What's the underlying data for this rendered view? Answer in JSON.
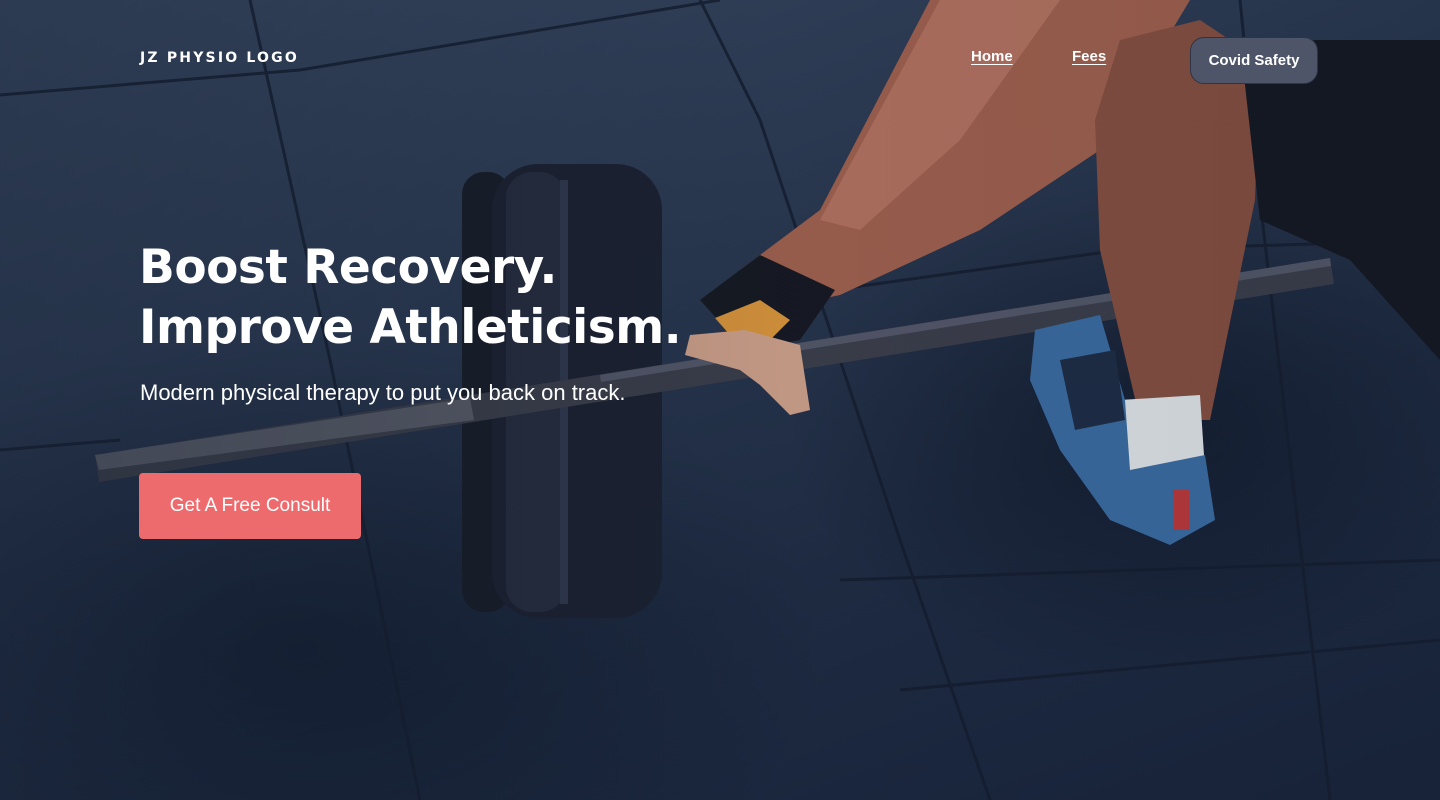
{
  "header": {
    "logo_text": "JZ PHYSIO LOGO",
    "nav": {
      "home_label": "Home",
      "fees_label": "Fees",
      "covid_label": "Covid Safety"
    }
  },
  "hero": {
    "headline_line1": "Boost Recovery.",
    "headline_line2": "Improve Athleticism.",
    "subheading": "Modern physical therapy to put you back on track.",
    "cta_label": "Get A Free Consult",
    "background_image": "person-lifting-barbell-photo"
  },
  "colors": {
    "cta_background": "#ee6b6d",
    "covid_button_background": "#4f5568",
    "overlay": "#1c2940",
    "text": "#ffffff"
  }
}
